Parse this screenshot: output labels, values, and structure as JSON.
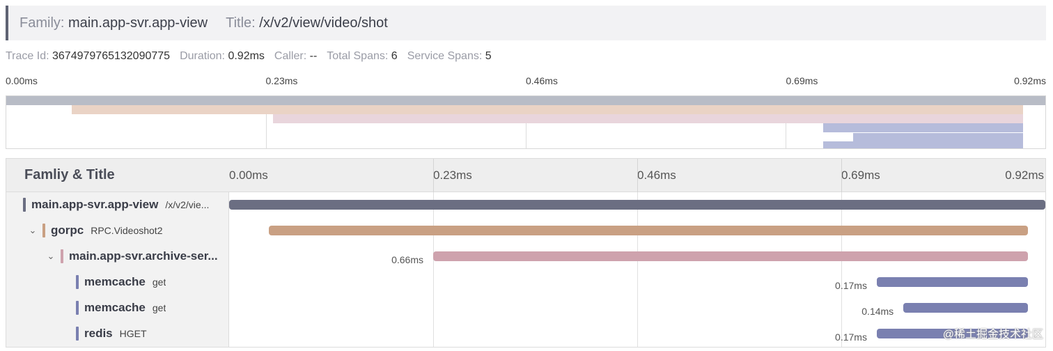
{
  "header": {
    "family_label": "Family:",
    "family_value": "main.app-svr.app-view",
    "title_label": "Title:",
    "title_value": "/x/v2/view/video/shot"
  },
  "meta": {
    "trace_id_label": "Trace Id:",
    "trace_id": "3674979765132090775",
    "duration_label": "Duration:",
    "duration": "0.92ms",
    "caller_label": "Caller:",
    "caller": "--",
    "total_spans_label": "Total Spans:",
    "total_spans": "6",
    "service_spans_label": "Service Spans:",
    "service_spans": "5"
  },
  "ticks": [
    "0.00ms",
    "0.23ms",
    "0.46ms",
    "0.69ms",
    "0.92ms"
  ],
  "timeline_header": "Famliy & Title",
  "spans": [
    {
      "family": "main.app-svr.app-view",
      "title": "/x/v2/vie...",
      "chevron": "",
      "color": "#6b6e82",
      "start": 0.0,
      "end": 0.92,
      "duration_label": ""
    },
    {
      "family": "gorpc",
      "title": "RPC.Videoshot2",
      "chevron": "⌄",
      "color": "#c9a083",
      "start": 0.045,
      "end": 0.9,
      "duration_label": ""
    },
    {
      "family": "main.app-svr.archive-ser...",
      "title": "",
      "chevron": "⌄",
      "color": "#cea2ad",
      "start": 0.23,
      "end": 0.9,
      "duration_label": "0.66ms"
    },
    {
      "family": "memcache",
      "title": "get",
      "chevron": "",
      "color": "#7a80b0",
      "start": 0.73,
      "end": 0.9,
      "duration_label": "0.17ms"
    },
    {
      "family": "memcache",
      "title": "get",
      "chevron": "",
      "color": "#7a80b0",
      "start": 0.76,
      "end": 0.9,
      "duration_label": "0.14ms"
    },
    {
      "family": "redis",
      "title": "HGET",
      "chevron": "",
      "color": "#7a80b0",
      "start": 0.73,
      "end": 0.9,
      "duration_label": "0.17ms"
    }
  ],
  "minimap": {
    "bars": [
      {
        "color": "#b8bcc6",
        "start": 0.0,
        "end": 0.92
      },
      {
        "color": "#ead3c5",
        "start": 0.058,
        "end": 0.9
      },
      {
        "color": "#e9d5dc",
        "start": 0.236,
        "end": 0.9
      },
      {
        "color": "#b6bcdb",
        "start": 0.723,
        "end": 0.9
      },
      {
        "color": "#b6bcdb",
        "start": 0.75,
        "end": 0.9
      },
      {
        "color": "#b6bcdb",
        "start": 0.723,
        "end": 0.9
      }
    ]
  },
  "watermark": "@稀土掘金技术社区"
}
